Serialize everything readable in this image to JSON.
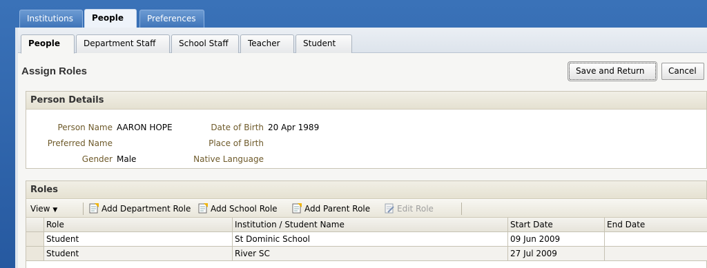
{
  "top_tabs": [
    {
      "label": "Institutions",
      "active": false
    },
    {
      "label": "People",
      "active": true
    },
    {
      "label": "Preferences",
      "active": false
    }
  ],
  "sub_tabs": [
    {
      "label": "People",
      "active": true
    },
    {
      "label": "Department Staff",
      "active": false
    },
    {
      "label": "School Staff",
      "active": false
    },
    {
      "label": "Teacher",
      "active": false
    },
    {
      "label": "Student",
      "active": false
    }
  ],
  "page": {
    "title": "Assign Roles",
    "save_label": "Save and Return",
    "cancel_label": "Cancel"
  },
  "person_details": {
    "heading": "Person Details",
    "name_label": "Person Name",
    "name_value": "AARON HOPE",
    "preferred_label": "Preferred Name",
    "preferred_value": "",
    "gender_label": "Gender",
    "gender_value": "Male",
    "dob_label": "Date of Birth",
    "dob_value": "20 Apr 1989",
    "pob_label": "Place of Birth",
    "pob_value": "",
    "lang_label": "Native Language",
    "lang_value": ""
  },
  "roles": {
    "heading": "Roles",
    "toolbar": {
      "view_label": "View",
      "add_department_role": "Add Department Role",
      "add_school_role": "Add School Role",
      "add_parent_role": "Add Parent Role",
      "edit_role": "Edit Role"
    },
    "columns": [
      "Role",
      "Institution / Student Name",
      "Start Date",
      "End Date"
    ],
    "rows": [
      {
        "role": "Student",
        "institution": "St Dominic School",
        "start": "09 Jun 2009",
        "end": ""
      },
      {
        "role": "Student",
        "institution": "River SC",
        "start": "27 Jul 2009",
        "end": ""
      }
    ]
  }
}
